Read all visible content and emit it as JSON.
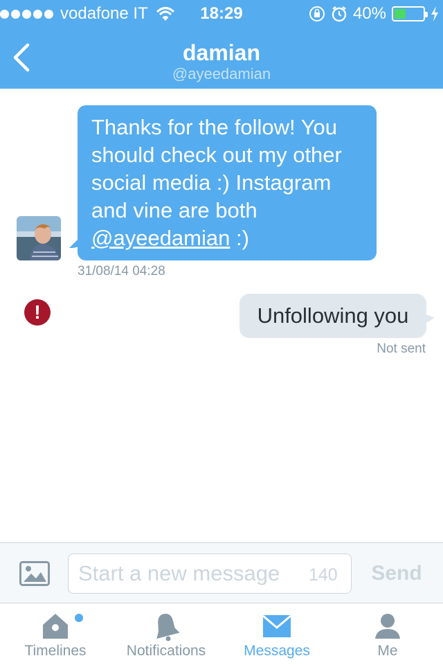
{
  "status_bar": {
    "carrier": "vodafone IT",
    "time": "18:29",
    "battery": "40%",
    "battery_level": 0.4
  },
  "nav": {
    "title": "damian",
    "subtitle": "@ayeedamian"
  },
  "messages": {
    "incoming": {
      "text_before": "Thanks for the follow! You should check out my other social media :) Instagram and vine are both ",
      "mention": "@ayeedamian",
      "text_after": " :)",
      "timestamp": "31/08/14 04:28"
    },
    "outgoing": {
      "text": "Unfollowing you",
      "status": "Not sent"
    }
  },
  "composer": {
    "placeholder": "Start a new message",
    "char_count": "140",
    "send_label": "Send"
  },
  "tabs": [
    {
      "label": "Timelines",
      "icon": "home-icon"
    },
    {
      "label": "Notifications",
      "icon": "bell-icon"
    },
    {
      "label": "Messages",
      "icon": "envelope-icon"
    },
    {
      "label": "Me",
      "icon": "person-icon"
    }
  ],
  "colors": {
    "brand": "#55acee",
    "error": "#a6172c",
    "battery": "#4cd964"
  }
}
